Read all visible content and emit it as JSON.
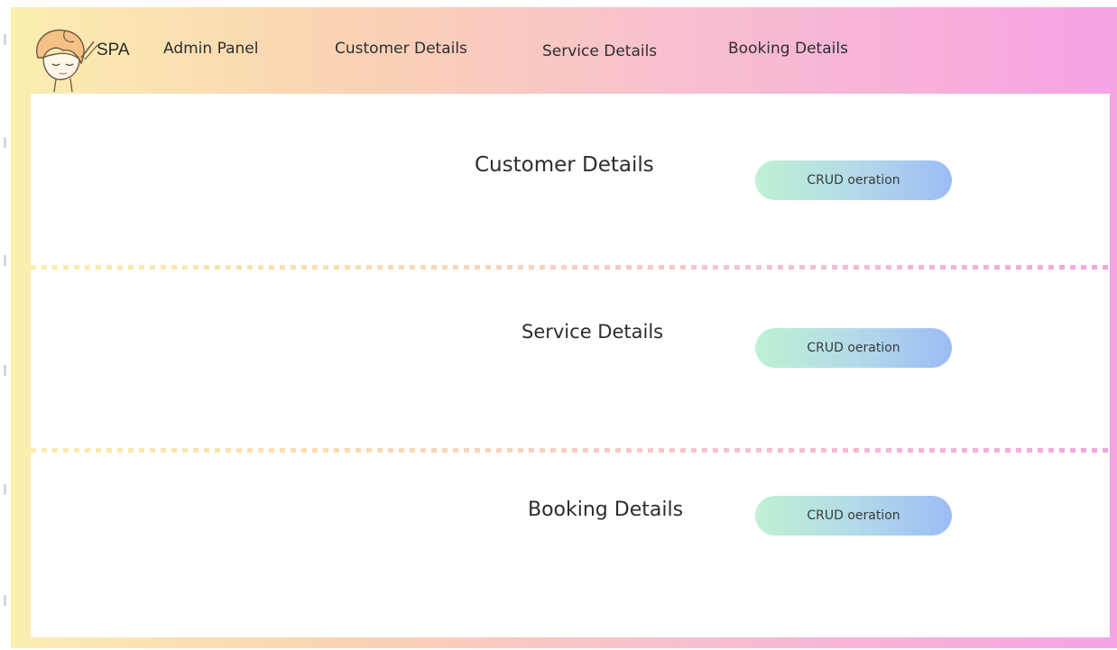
{
  "nav": {
    "brand": "SPA",
    "links": [
      "Admin Panel",
      "Customer Details",
      "Service Details",
      "Booking Details"
    ]
  },
  "sections": [
    {
      "title": "Customer Details",
      "button": "CRUD oeration"
    },
    {
      "title": "Service Details",
      "button": "CRUD oeration"
    },
    {
      "title": "Booking Details",
      "button": "CRUD oeration"
    }
  ],
  "colors": {
    "frame_gradient": [
      "#fbeeb0",
      "#fad3b3",
      "#f8c0cf",
      "#f7a3e6"
    ],
    "button_gradient": [
      "#bff1d2",
      "#9bbcf5"
    ],
    "panel": "#ffffff"
  },
  "icons": {
    "logo": "spa-woman-logo"
  }
}
